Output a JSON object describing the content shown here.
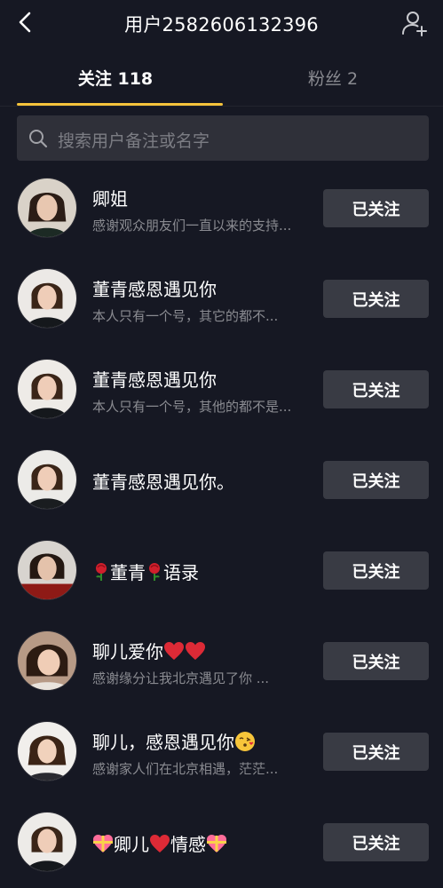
{
  "header": {
    "title": "用户2582606132396",
    "back_icon": "back-arrow-icon",
    "action_icon": "add-user-icon"
  },
  "tabs": [
    {
      "label": "关注 118",
      "active": true
    },
    {
      "label": "粉丝 2",
      "active": false
    }
  ],
  "search": {
    "placeholder": "搜索用户备注或名字"
  },
  "colors": {
    "background": "#161823",
    "accent": "#f5c33b",
    "button": "#393b44",
    "muted_text": "#8a8b91"
  },
  "follow_list": [
    {
      "name": "卿姐",
      "desc": "感谢观众朋友们一直以来的支持...",
      "button": "已关注"
    },
    {
      "name": "董青感恩遇见你",
      "desc": "本人只有一个号，其它的都不...",
      "button": "已关注"
    },
    {
      "name": "董青感恩遇见你",
      "desc": "本人只有一个号，其他的都不是...",
      "button": "已关注"
    },
    {
      "name": "董青感恩遇见你。",
      "desc": "",
      "button": "已关注"
    },
    {
      "name_parts": [
        "rose-emoji",
        "董青",
        "rose-emoji",
        "语录"
      ],
      "name": "董青语录",
      "desc": "",
      "button": "已关注"
    },
    {
      "name_parts": [
        "聊儿爱你",
        "heart-emoji",
        "heart-emoji"
      ],
      "name": "聊儿爱你",
      "desc": "感谢缘分让我北京遇见了你 ...",
      "button": "已关注"
    },
    {
      "name_parts": [
        "聊儿，感恩遇见你",
        "kiss-emoji"
      ],
      "name": "聊儿，感恩遇见你",
      "desc": "感谢家人们在北京相遇，茫茫...",
      "button": "已关注"
    },
    {
      "name_parts": [
        "gift-heart-emoji",
        "卿儿",
        "heart-emoji",
        "情感",
        "gift-heart-emoji"
      ],
      "name_a": "卿儿",
      "name_b": "情感",
      "desc": "",
      "button": "已关注"
    }
  ]
}
